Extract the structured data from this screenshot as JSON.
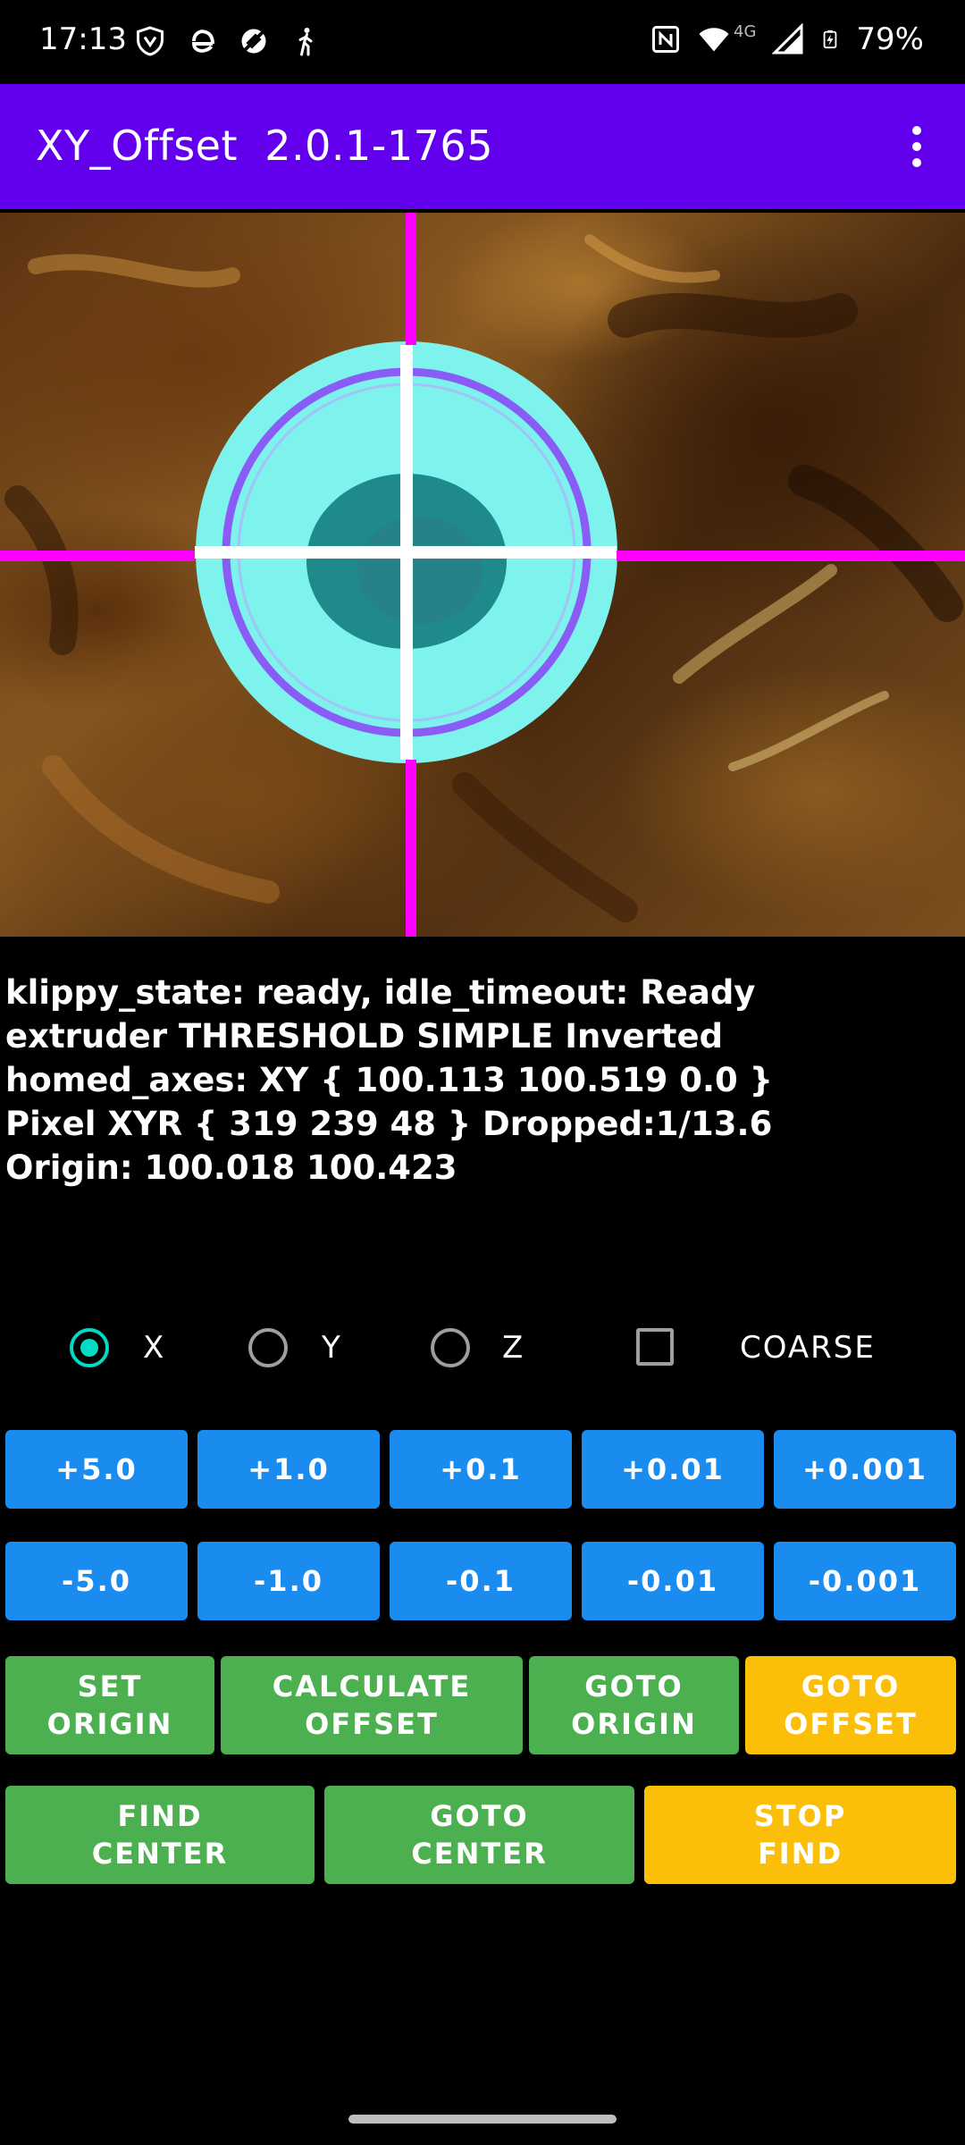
{
  "status_bar": {
    "time": "17:13",
    "network": "4G",
    "battery": "79%",
    "left_icons": [
      "vpn-shield-icon",
      "edge-browser-icon",
      "sync-off-icon",
      "accessibility-walk-icon"
    ],
    "right_icons": [
      "nfc-icon",
      "wifi-icon",
      "signal-icon",
      "battery-charging-icon"
    ]
  },
  "app_bar": {
    "title": "XY_Offset  2.0.1-1765",
    "color": "#6200ee",
    "menu_icon": "more-vert-icon"
  },
  "camera": {
    "description_icon": "camera-feed",
    "crosshair_color": "#ff00ff",
    "ring_color": "#8a5cf6",
    "target_color": "#7ef2ec"
  },
  "info": {
    "line1": "klippy_state: ready, idle_timeout: Ready",
    "line2": "extruder THRESHOLD SIMPLE Inverted",
    "line3": "homed_axes: XY { 100.113 100.519 0.0 }",
    "line4": "Pixel XYR { 319 239 48 } Dropped:1/13.6",
    "line5": "Origin: 100.018 100.423"
  },
  "axes": {
    "x_label": "X",
    "y_label": "Y",
    "z_label": "Z",
    "selected": "X",
    "coarse_label": "COARSE",
    "coarse_checked": false
  },
  "plus_buttons": [
    "+5.0",
    "+1.0",
    "+0.1",
    "+0.01",
    "+0.001"
  ],
  "minus_buttons": [
    "-5.0",
    "-1.0",
    "-0.1",
    "-0.01",
    "-0.001"
  ],
  "actions1": {
    "set_origin": "SET\nORIGIN",
    "calculate_offset": "CALCULATE\nOFFSET",
    "goto_origin": "GOTO\nORIGIN",
    "goto_offset": "GOTO\nOFFSET"
  },
  "actions2": {
    "find_center": "FIND\nCENTER",
    "goto_center": "GOTO\nCENTER",
    "stop_find": "STOP\nFIND"
  },
  "colors": {
    "blue_button": "#1a8cf0",
    "green_button": "#4caf50",
    "yellow_button": "#fbbf0a"
  }
}
